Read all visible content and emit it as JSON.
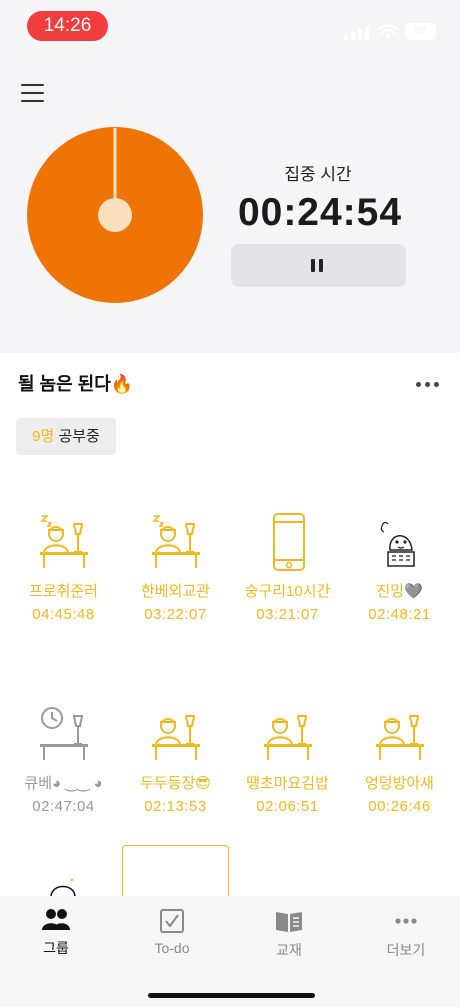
{
  "status": {
    "time": "14:26",
    "battery": "57"
  },
  "timer": {
    "label": "집중 시간",
    "value": "00:24:54",
    "color": "#f07305"
  },
  "group": {
    "title": "될 놈은 된다🔥",
    "studying_count": "9명",
    "studying_label": "공부중"
  },
  "accent": "#f2b81f",
  "members": [
    {
      "name": "프로취준러",
      "time": "04:45:48",
      "icon": "sleeping-desk-icon",
      "active": true
    },
    {
      "name": "한베외교관",
      "time": "03:22:07",
      "icon": "sleeping-desk-icon",
      "active": true
    },
    {
      "name": "숭구리10시간",
      "time": "03:21:07",
      "icon": "phone-icon",
      "active": true
    },
    {
      "name": "진밍🩶",
      "time": "02:48:21",
      "icon": "custom-avatar-icon",
      "active": true
    },
    {
      "name": "큐베◕ ‿‿ ◕",
      "time": "02:47:04",
      "icon": "clock-desk-icon",
      "active": false
    },
    {
      "name": "두두등장😎",
      "time": "02:13:53",
      "icon": "studying-desk-icon",
      "active": true
    },
    {
      "name": "땡초마요김밥",
      "time": "02:06:51",
      "icon": "studying-desk-icon",
      "active": true
    },
    {
      "name": "엉덩방아새",
      "time": "00:26:46",
      "icon": "studying-desk-icon",
      "active": true
    }
  ],
  "tabs": [
    {
      "label": "그룹",
      "icon": "group-icon",
      "active": true
    },
    {
      "label": "To-do",
      "icon": "checkbox-icon",
      "active": false
    },
    {
      "label": "교재",
      "icon": "book-icon",
      "active": false
    },
    {
      "label": "더보기",
      "icon": "more-icon",
      "active": false
    }
  ]
}
